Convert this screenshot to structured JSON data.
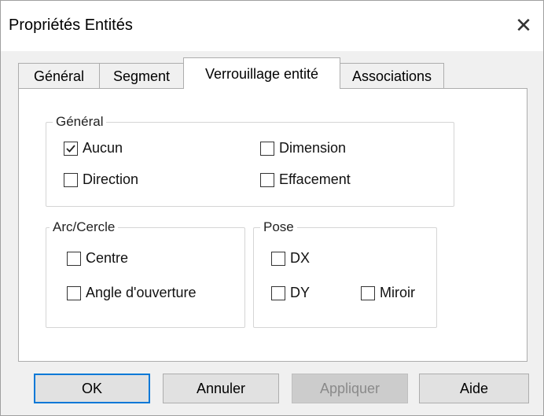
{
  "window": {
    "title": "Propriétés Entités",
    "close_glyph": "✕"
  },
  "tabs": [
    {
      "label": "Général",
      "active": false
    },
    {
      "label": "Segment",
      "active": false
    },
    {
      "label": "Verrouillage entité",
      "active": true
    },
    {
      "label": "Associations",
      "active": false
    }
  ],
  "groups": {
    "general": {
      "legend": "Général",
      "options": [
        {
          "label": "Aucun",
          "checked": true
        },
        {
          "label": "Dimension",
          "checked": false
        },
        {
          "label": "Direction",
          "checked": false
        },
        {
          "label": "Effacement",
          "checked": false
        }
      ]
    },
    "arc_cercle": {
      "legend": "Arc/Cercle",
      "options": [
        {
          "label": "Centre",
          "checked": false
        },
        {
          "label": "Angle d'ouverture",
          "checked": false
        }
      ]
    },
    "pose": {
      "legend": "Pose",
      "options": [
        {
          "label": "DX",
          "checked": false
        },
        {
          "label": "DY",
          "checked": false
        },
        {
          "label": "Miroir",
          "checked": false
        }
      ]
    }
  },
  "buttons": {
    "ok": "OK",
    "cancel": "Annuler",
    "apply": "Appliquer",
    "help": "Aide"
  },
  "colors": {
    "default_button_border": "#0078d7",
    "dialog_background": "#f0f0f0",
    "panel_background": "#ffffff"
  },
  "icons": {
    "close": "close-icon",
    "check": "checkmark-icon"
  }
}
